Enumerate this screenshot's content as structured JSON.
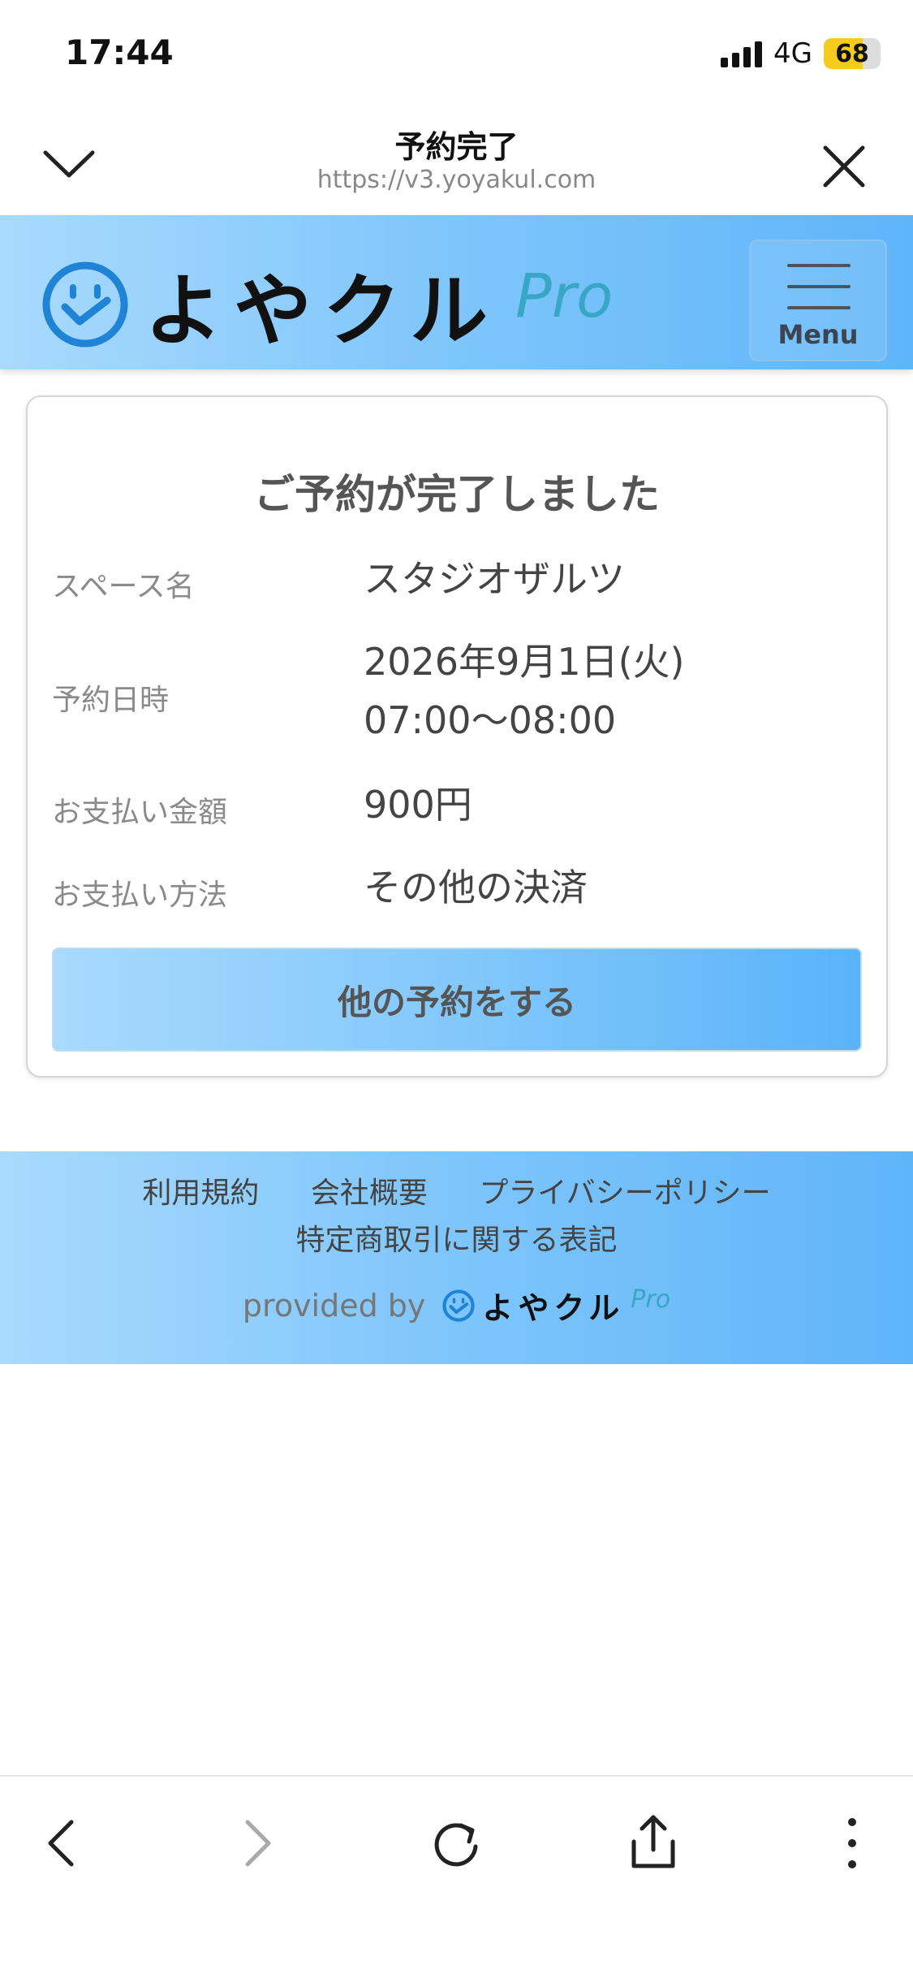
{
  "status": {
    "time": "17:44",
    "network": "4G",
    "battery": "68",
    "battery_level": 0.68
  },
  "browser": {
    "title": "予約完了",
    "url": "https://v3.yoyakul.com",
    "collapse_icon": "chevron-down-icon",
    "close_icon": "close-icon"
  },
  "header": {
    "logo_text": "よやクル",
    "logo_pro": "Pro",
    "menu_label": "Menu",
    "colors": {
      "gradient_start": "#a9dafd",
      "gradient_end": "#5fb5f9",
      "logo_blue": "#1f84d6"
    }
  },
  "card": {
    "title": "ご予約が完了しました",
    "rows": [
      {
        "label": "スペース名",
        "value": "スタジオザルツ"
      },
      {
        "label": "予約日時",
        "value_line1": "2026年9月1日(火)",
        "value_line2": "07:00〜08:00"
      },
      {
        "label": "お支払い金額",
        "value": "900円"
      },
      {
        "label": "お支払い方法",
        "value": "その他の決済"
      }
    ],
    "cta_label": "他の予約をする"
  },
  "footer": {
    "links": [
      "利用規約",
      "会社概要",
      "プライバシーポリシー"
    ],
    "link_2": "特定商取引に関する表記",
    "provided_by": "provided by",
    "logo_text": "よやクル",
    "logo_pro": "Pro"
  },
  "bottom_nav": [
    "back-icon",
    "forward-icon",
    "reload-icon",
    "share-icon",
    "more-icon"
  ]
}
